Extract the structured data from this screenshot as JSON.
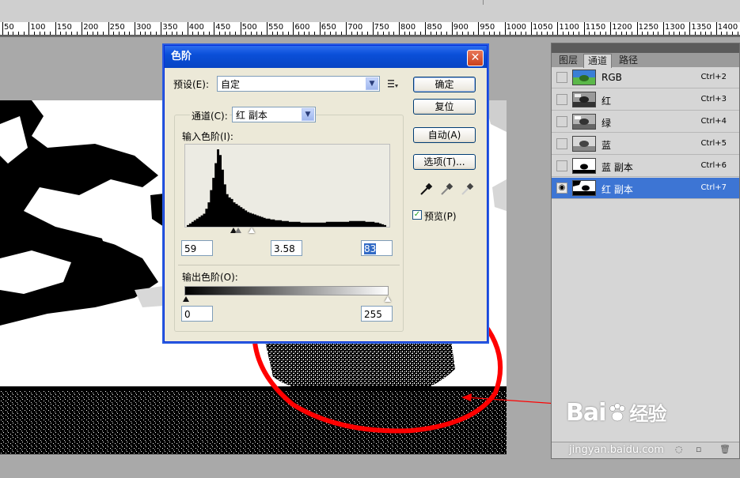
{
  "ruler": {
    "labels": [
      "50",
      "100",
      "150",
      "200",
      "250",
      "300",
      "350",
      "400",
      "450",
      "500",
      "550",
      "600",
      "650",
      "700",
      "750",
      "800",
      "850",
      "900",
      "950",
      "1000",
      "1050",
      "1100",
      "1150",
      "1200",
      "1250",
      "1300",
      "1350",
      "1400"
    ]
  },
  "dialog": {
    "title": "色阶",
    "close_glyph": "✕",
    "preset_label": "预设(E):",
    "preset_value": "自定",
    "channel_label": "通道(C):",
    "channel_value": "红 副本",
    "input_levels_label": "输入色阶(I):",
    "input_black": "59",
    "input_gamma": "3.58",
    "input_white": "83",
    "output_levels_label": "输出色阶(O):",
    "output_black": "0",
    "output_white": "255",
    "buttons": {
      "ok": "确定",
      "reset": "复位",
      "auto": "自动(A)",
      "options": "选项(T)..."
    },
    "preview_label": "预览(P)",
    "preview_checked": true,
    "histogram": [
      2,
      4,
      6,
      8,
      10,
      12,
      14,
      16,
      22,
      30,
      45,
      60,
      78,
      95,
      88,
      70,
      52,
      40,
      36,
      34,
      30,
      28,
      26,
      24,
      22,
      20,
      18,
      17,
      16,
      15,
      14,
      13,
      12,
      11,
      10,
      10,
      9,
      9,
      8,
      8,
      8,
      7,
      7,
      7,
      6,
      6,
      6,
      6,
      6,
      5,
      5,
      5,
      5,
      5,
      5,
      5,
      5,
      5,
      5,
      5,
      6,
      6,
      6,
      6,
      6,
      6,
      6,
      6,
      6,
      6,
      7,
      7,
      7,
      7,
      7,
      7,
      7,
      6,
      6,
      6,
      6,
      5,
      5,
      4,
      3,
      2
    ]
  },
  "channels_panel": {
    "tabs": [
      "图层",
      "通道",
      "路径"
    ],
    "active_tab": 1,
    "rows": [
      {
        "name": "RGB",
        "shortcut": "Ctrl+2",
        "visible": false,
        "selected": false
      },
      {
        "name": "红",
        "shortcut": "Ctrl+3",
        "visible": false,
        "selected": false
      },
      {
        "name": "绿",
        "shortcut": "Ctrl+4",
        "visible": false,
        "selected": false
      },
      {
        "name": "蓝",
        "shortcut": "Ctrl+5",
        "visible": false,
        "selected": false
      },
      {
        "name": "蓝 副本",
        "shortcut": "Ctrl+6",
        "visible": false,
        "selected": false
      },
      {
        "name": "红 副本",
        "shortcut": "Ctrl+7",
        "visible": true,
        "selected": true
      }
    ],
    "eye_glyph": "◉"
  },
  "watermark": {
    "logo": "Bai",
    "logo_suffix": "经验",
    "url": "jingyan.baidu.com"
  },
  "annotation_color": "#ff0000",
  "accent_blue": "#3d75d4"
}
